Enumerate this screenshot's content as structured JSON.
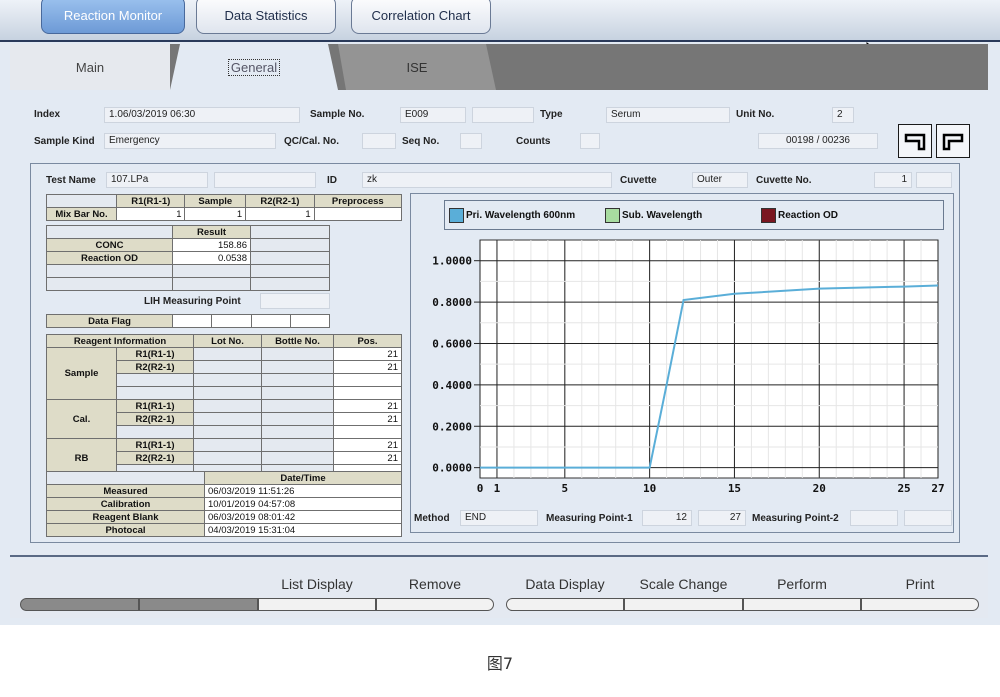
{
  "top_tabs": [
    "Reaction Monitor",
    "Data Statistics",
    "Correlation Chart"
  ],
  "sub_tabs": [
    "Main",
    "General",
    "ISE"
  ],
  "header": {
    "index_label": "Index",
    "index_value": "1.06/03/2019 06:30",
    "sample_no_label": "Sample No.",
    "sample_no_value": "E009",
    "type_label": "Type",
    "type_value": "Serum",
    "unit_no_label": "Unit No.",
    "unit_no_value": "2",
    "sample_kind_label": "Sample Kind",
    "sample_kind_value": "Emergency",
    "qc_label": "QC/Cal. No.",
    "seq_label": "Seq No.",
    "counts_label": "Counts",
    "counter_value": "00198 / 00236"
  },
  "test": {
    "name_label": "Test Name",
    "name_value": "107.LPa",
    "id_label": "ID",
    "id_value": "zk",
    "cuvette_label": "Cuvette",
    "cuvette_value": "Outer",
    "cuvette_no_label": "Cuvette No.",
    "cuvette_no_value": "1"
  },
  "mix_table": {
    "headers": [
      "R1(R1-1)",
      "Sample",
      "R2(R2-1)",
      "Preprocess"
    ],
    "row_label": "Mix Bar No.",
    "values": [
      "1",
      "1",
      "1",
      ""
    ]
  },
  "result_table": {
    "header": "Result",
    "rows": [
      {
        "label": "CONC",
        "value": "158.86"
      },
      {
        "label": "Reaction OD",
        "value": "0.0538"
      }
    ]
  },
  "lih_label": "LIH Measuring Point",
  "data_flag_label": "Data Flag",
  "reagent_table": {
    "headers": [
      "Reagent Information",
      "Lot No.",
      "Bottle No.",
      "Pos."
    ],
    "groups": [
      {
        "name": "Sample",
        "rows": [
          {
            "label": "R1(R1-1)",
            "pos": "21"
          },
          {
            "label": "R2(R2-1)",
            "pos": "21"
          }
        ]
      },
      {
        "name": "Cal.",
        "rows": [
          {
            "label": "R1(R1-1)",
            "pos": "21"
          },
          {
            "label": "R2(R2-1)",
            "pos": "21"
          }
        ]
      },
      {
        "name": "RB",
        "rows": [
          {
            "label": "R1(R1-1)",
            "pos": "21"
          },
          {
            "label": "R2(R2-1)",
            "pos": "21"
          }
        ]
      }
    ]
  },
  "date_table": {
    "header": "Date/Time",
    "rows": [
      {
        "label": "Measured",
        "value": "06/03/2019 11:51:26"
      },
      {
        "label": "Calibration",
        "value": "10/01/2019 04:57:08"
      },
      {
        "label": "Reagent Blank",
        "value": "06/03/2019 08:01:42"
      },
      {
        "label": "Photocal",
        "value": "04/03/2019 15:31:04"
      }
    ]
  },
  "legend": [
    {
      "label": "Pri. Wavelength 600nm",
      "color": "#5aaed8"
    },
    {
      "label": "Sub. Wavelength",
      "color": "#a8dca0"
    },
    {
      "label": "Reaction OD",
      "color": "#7a1620"
    }
  ],
  "method": {
    "method_label": "Method",
    "method_value": "END",
    "mp1_label": "Measuring Point-1",
    "mp1_from": "12",
    "mp1_to": "27",
    "mp2_label": "Measuring Point-2"
  },
  "bottom_buttons": [
    "List Display",
    "Remove",
    "Data Display",
    "Scale Change",
    "Perform",
    "Print"
  ],
  "caption": "图7",
  "chart_data": {
    "type": "line",
    "title": "",
    "xlabel": "",
    "ylabel": "",
    "xlim": [
      0,
      27
    ],
    "ylim": [
      -0.05,
      1.1
    ],
    "x_ticks": [
      "0",
      "1",
      "5",
      "10",
      "15",
      "20",
      "25",
      "27"
    ],
    "y_ticks": [
      "1.0000",
      "0.8000",
      "0.6000",
      "0.4000",
      "0.2000",
      "0.0000"
    ],
    "grid": true,
    "series": [
      {
        "name": "Pri. Wavelength 600nm",
        "color": "#5aaed8",
        "x": [
          0,
          1,
          5,
          10,
          11,
          12,
          15,
          20,
          25,
          27
        ],
        "y": [
          0.0,
          0.0,
          0.0,
          0.0,
          0.4,
          0.81,
          0.84,
          0.865,
          0.875,
          0.88
        ]
      }
    ]
  }
}
